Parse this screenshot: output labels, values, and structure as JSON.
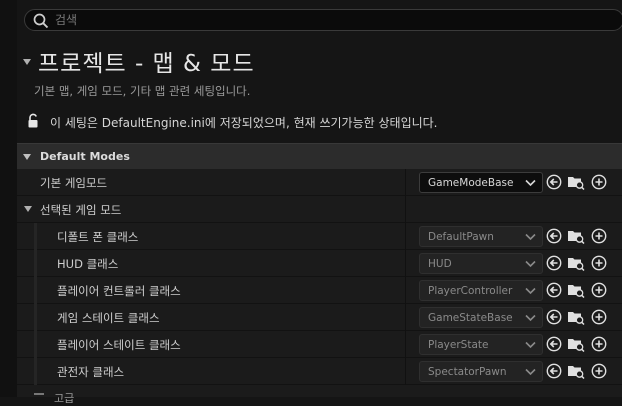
{
  "search": {
    "placeholder": "검색"
  },
  "section": {
    "title": "프로젝트 - 맵 & 모드",
    "description": "기본 맵, 게임 모드, 기타 맵 관련 세팅입니다.",
    "lock_message": "이 세팅은 DefaultEngine.ini에 저장되었으며, 현재 쓰기가능한 상태입니다."
  },
  "category": {
    "label": "Default Modes"
  },
  "rows": {
    "default_game_mode": {
      "label": "기본 게임모드",
      "value": "GameModeBase"
    },
    "selected_game_mode": {
      "label": "선택된 게임 모드"
    },
    "default_pawn": {
      "label": "디폴트 폰 클래스",
      "value": "DefaultPawn"
    },
    "hud": {
      "label": "HUD 클래스",
      "value": "HUD"
    },
    "player_controller": {
      "label": "플레이어 컨트롤러 클래스",
      "value": "PlayerController"
    },
    "game_state": {
      "label": "게임 스테이트 클래스",
      "value": "GameStateBase"
    },
    "player_state": {
      "label": "플레이어 스테이트 클래스",
      "value": "PlayerState"
    },
    "spectator": {
      "label": "관전자 클래스",
      "value": "SpectatorPawn"
    }
  },
  "next_category_partial": "고급",
  "colors": {
    "background": "#151515",
    "category_bg": "#2c2c2c",
    "row_bg": "#1b1b1b",
    "text": "#cfcfcf"
  }
}
